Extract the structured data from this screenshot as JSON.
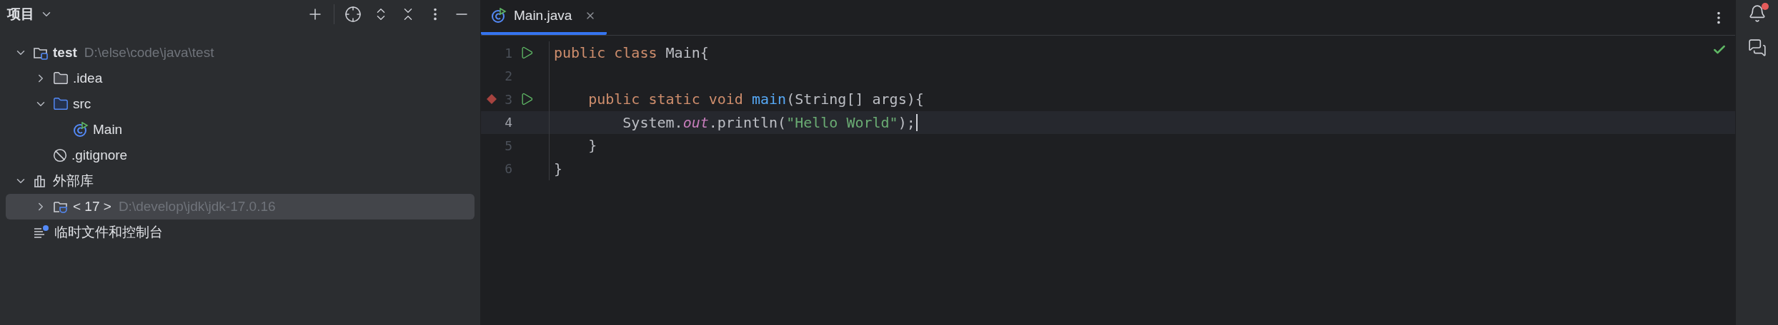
{
  "project_panel": {
    "title": "项目",
    "tree": [
      {
        "kind": "module",
        "name": "test",
        "hint": "D:\\else\\code\\java\\test",
        "expanded": true,
        "selected": false,
        "children": [
          {
            "kind": "folder",
            "name": ".idea",
            "expanded": false,
            "selected": false
          },
          {
            "kind": "source",
            "name": "src",
            "expanded": true,
            "selected": false,
            "children": [
              {
                "kind": "class",
                "name": "Main",
                "selected": false
              }
            ]
          },
          {
            "kind": "ignore",
            "name": ".gitignore",
            "selected": false
          }
        ]
      },
      {
        "kind": "library",
        "name": "外部库",
        "expanded": true,
        "selected": false,
        "children": [
          {
            "kind": "jdk",
            "name": "< 17 >",
            "hint": "D:\\develop\\jdk\\jdk-17.0.16",
            "expanded": false,
            "selected": true
          }
        ]
      },
      {
        "kind": "scratches",
        "name": "临时文件和控制台",
        "selected": false
      }
    ]
  },
  "editor": {
    "tabs": [
      {
        "label": "Main.java",
        "selected": true
      }
    ],
    "lines": [
      {
        "number": "1",
        "run": true,
        "breakpoint": false,
        "current": false,
        "tokens": [
          {
            "kind": "keyword",
            "text": "public class "
          },
          {
            "kind": "plain",
            "text": "Main{"
          }
        ]
      },
      {
        "number": "2",
        "run": false,
        "breakpoint": false,
        "current": false
      },
      {
        "number": "3",
        "run": true,
        "breakpoint": true,
        "current": false,
        "tokens": [
          {
            "kind": "keyword",
            "text": "    public static void "
          },
          {
            "kind": "method",
            "text": "main"
          },
          {
            "kind": "plain",
            "text": "(String[] args){"
          }
        ]
      },
      {
        "number": "4",
        "run": false,
        "breakpoint": false,
        "current": true,
        "tokens": [
          {
            "kind": "plain",
            "text": "        System."
          },
          {
            "kind": "field",
            "text": "out"
          },
          {
            "kind": "plain",
            "text": ".println("
          },
          {
            "kind": "string",
            "text": "\"Hello World\""
          },
          {
            "kind": "plain",
            "text": ");"
          }
        ]
      },
      {
        "number": "5",
        "run": false,
        "breakpoint": false,
        "current": false,
        "tokens": [
          {
            "kind": "plain",
            "text": "    }"
          }
        ]
      },
      {
        "number": "6",
        "run": false,
        "breakpoint": false,
        "current": false,
        "tokens": [
          {
            "kind": "plain",
            "text": "}"
          }
        ]
      }
    ],
    "no_problems": true
  },
  "notifications": {
    "unread": true
  }
}
